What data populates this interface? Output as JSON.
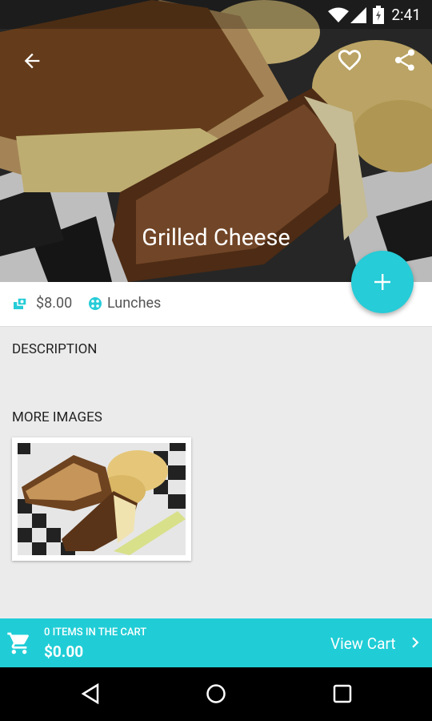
{
  "status": {
    "time": "2:41"
  },
  "product": {
    "title": "Grilled Cheese",
    "price": "$8.00",
    "category": "Lunches"
  },
  "sections": {
    "description": "DESCRIPTION",
    "more_images": "MORE IMAGES"
  },
  "cart": {
    "items_label": "0 ITEMS IN THE CART",
    "total": "$0.00",
    "view_cart": "View Cart"
  },
  "icons": {
    "back": "arrow-back-icon",
    "favorite": "heart-outline-icon",
    "share": "share-icon",
    "add": "plus-icon",
    "price": "price-tag-icon",
    "category": "category-icon",
    "cart": "shopping-cart-icon",
    "chevron": "chevron-right-icon"
  },
  "colors": {
    "accent": "#26ccd7",
    "cartbar": "#20cdd6"
  }
}
